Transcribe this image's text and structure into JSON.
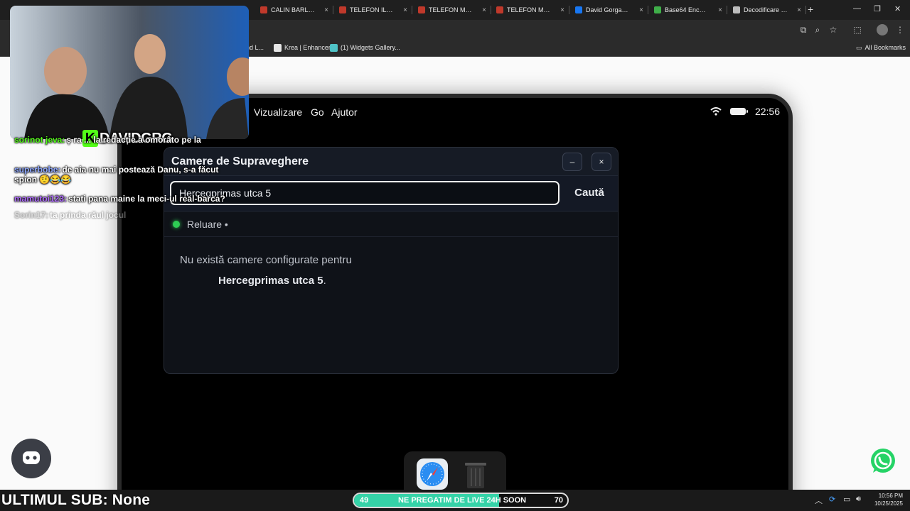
{
  "browser": {
    "tabs": [
      {
        "label": "CALIN BARLEA TE",
        "favicon_color": "#c0392b"
      },
      {
        "label": "TELEFON ILINCA",
        "favicon_color": "#c0392b"
      },
      {
        "label": "TELEFON MARIA",
        "favicon_color": "#c0392b"
      },
      {
        "label": "TELEFON MARIAN",
        "favicon_color": "#c0392b"
      },
      {
        "label": "David Gorgan | M",
        "favicon_color": "#1877f2"
      },
      {
        "label": "Base64 Encode ar",
        "favicon_color": "#3fae49"
      },
      {
        "label": "Decodificare Base",
        "favicon_color": "#bdbdbd"
      }
    ],
    "bookmarks": [
      {
        "label": "nd L...",
        "icon_color": "#2b2b2b"
      },
      {
        "label": "Krea | Enhancer",
        "icon_color": "#e6e6e6"
      },
      {
        "label": "(1) Widgets Gallery...",
        "icon_color": "#4fc3c7"
      }
    ],
    "all_bookmarks_label": "All Bookmarks"
  },
  "tablet": {
    "menu": [
      "Vizualizare",
      "Go",
      "Ajutor"
    ],
    "time": "22:56",
    "dialog": {
      "title": "Camere de Supraveghere",
      "minimize_label": "–",
      "close_label": "×",
      "search_value": "Hercegprimas utca 5",
      "search_button": "Caută",
      "status_text": "Reluare •",
      "status_color": "#2ecc54",
      "message_prefix": "Nu există camere configurate pentru",
      "message_location": "Hercegprimas utca 5",
      "message_suffix": "."
    },
    "dock": [
      "safari-icon",
      "trash-icon"
    ]
  },
  "stream": {
    "brand_letter": "K",
    "brand_name": "DAVIDGRG",
    "chat": [
      {
        "user": "sorinot jeva:",
        "user_color": "#53fc18",
        "text": "ș ra ... la redacție a omorâto pe la",
        "faded": false
      },
      {
        "user": "superbobe:",
        "user_color": "#8fa8ff",
        "text": "de aia nu mai postează Danu, s-a făcut spion 🤨😂😂",
        "faded": false
      },
      {
        "user": "mamutoi123:",
        "user_color": "#b06bff",
        "text": "stati pana maine la meci-ul real-barca?",
        "faded": false
      },
      {
        "user": "Sorin17:",
        "user_color": "#9a9a9a",
        "text": "ta prinda răul jocul",
        "faded": true
      }
    ],
    "last_sub_label": "ULTIMUL SUB: None",
    "goal": {
      "start": "49",
      "end": "70",
      "text": "NE PREGATIM DE LIVE 24H SOON",
      "progress": 0.68,
      "color": "#35d3a8"
    },
    "clock_time": "10:56 PM",
    "clock_date": "10/25/2025"
  }
}
